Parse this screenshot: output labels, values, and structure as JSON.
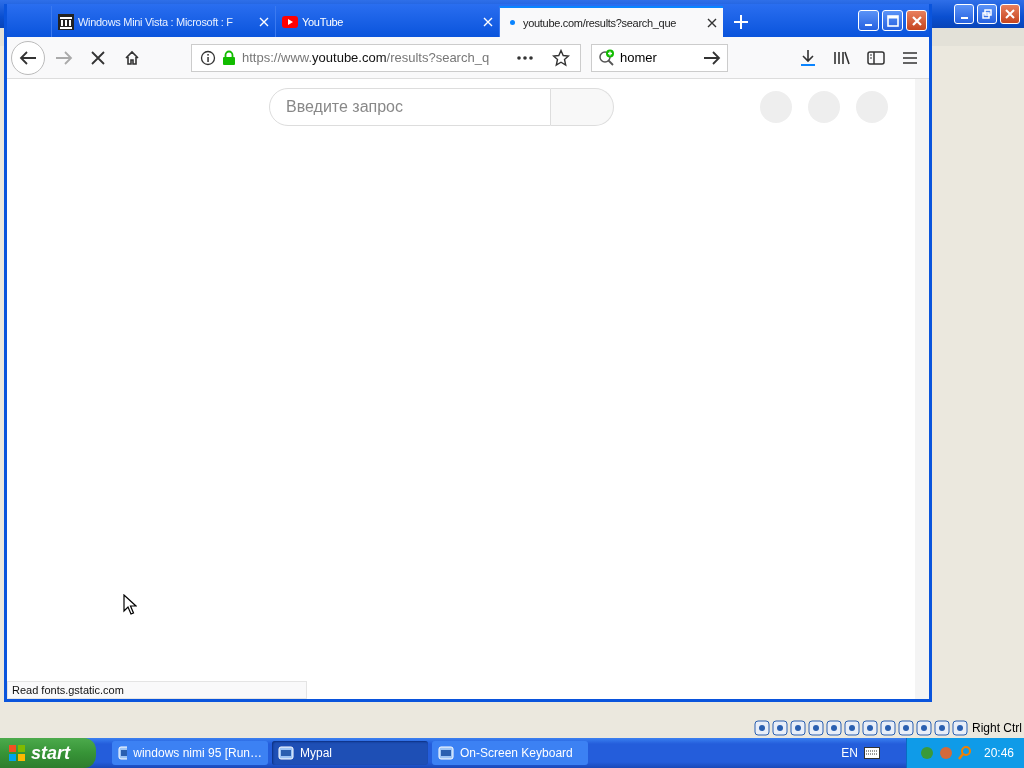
{
  "browser": {
    "tabs": [
      {
        "title": "Windows Mini Vista : Microsoft : F",
        "kind": "archive",
        "selected": false,
        "loading": false
      },
      {
        "title": "YouTube",
        "kind": "youtube",
        "selected": false,
        "loading": false
      },
      {
        "title": "youtube.com/results?search_que",
        "kind": "plain",
        "selected": true,
        "loading": true
      }
    ],
    "url": {
      "prefix": "https://www.",
      "host": "youtube.com",
      "path": "/results?search_q"
    },
    "search": {
      "value": "homer"
    },
    "page": {
      "search_placeholder": "Введите запрос"
    },
    "status": "Read fonts.gstatic.com"
  },
  "host_status": {
    "label": "Right Ctrl"
  },
  "taskbar": {
    "start": "start",
    "tasks": [
      {
        "label": "windows nimi 95 [Run…",
        "selected": false
      },
      {
        "label": "Mypal",
        "selected": true
      },
      {
        "label": "On-Screen Keyboard",
        "selected": false
      }
    ],
    "language": "EN",
    "clock": "20:46"
  }
}
